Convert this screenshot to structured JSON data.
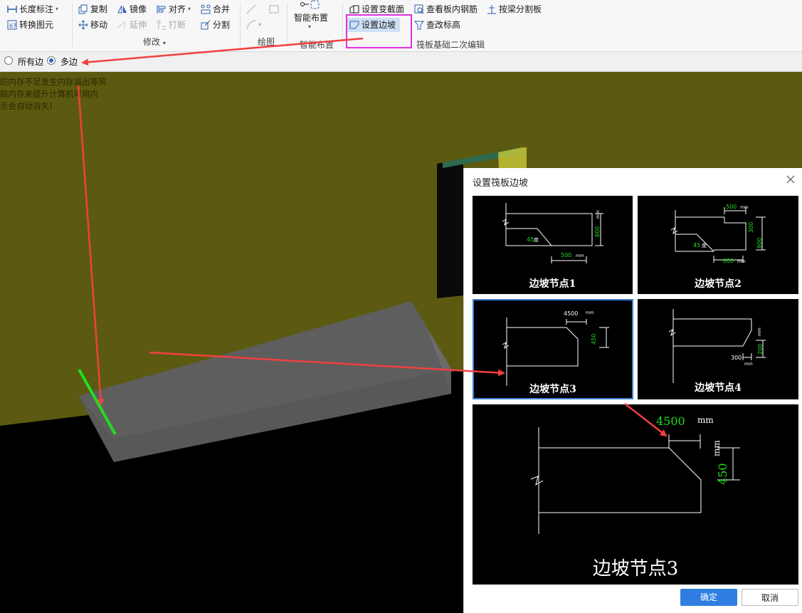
{
  "ribbon": {
    "length_dim": "长度标注",
    "convert": "转换图元",
    "copy": "复制",
    "mirror": "镜像",
    "align": "对齐",
    "merge": "合并",
    "move": "移动",
    "extend": "延伸",
    "break": "打断",
    "split": "分割",
    "group_modify": "修改",
    "group_draw": "绘图",
    "smart_place": "智能布置",
    "group_smart": "智能布置",
    "set_section": "设置变截面",
    "view_rebar": "查看板内钢筋",
    "split_by_beam": "按梁分割板",
    "set_slope": "设置边坡",
    "change_elev": "查改标高",
    "group_raft": "筏板基础二次编辑"
  },
  "options": {
    "all_edges": "所有边",
    "multi_edges": "多边",
    "selected": "multi_edges"
  },
  "viewport": {
    "warning_lines": [
      "防内存不足发生内存溢出等风",
      "脑内存来提升计算机可用内",
      "示会自动消失)"
    ]
  },
  "dialog": {
    "title": "设置筏板边坡",
    "nodes": [
      {
        "label": "边坡节点1",
        "angle": "45",
        "angle_unit": "度",
        "width": "500",
        "height": "800",
        "unit": "mm"
      },
      {
        "label": "边坡节点2",
        "top": "500",
        "height1": "300",
        "height2": "800",
        "angle": "45",
        "angle_unit": "度",
        "width": "600",
        "unit": "mm"
      },
      {
        "label": "边坡节点3",
        "width": "4500",
        "height": "450",
        "unit": "mm"
      },
      {
        "label": "边坡节点4",
        "height": "200",
        "width": "300",
        "unit": "mm"
      }
    ],
    "selected_index": 2,
    "preview": {
      "label": "边坡节点3",
      "width": "4500",
      "height": "450",
      "unit": "mm"
    },
    "ok": "确定",
    "cancel": "取消"
  },
  "colors": {
    "wall": "#5b5a10",
    "slab": "#5c5c5c",
    "annotation_arrow": "#f04040",
    "highlight_box": "#e030e0",
    "green_edge": "#22dd22",
    "dim_text": "#22dd22",
    "accent": "#2f7de1"
  }
}
